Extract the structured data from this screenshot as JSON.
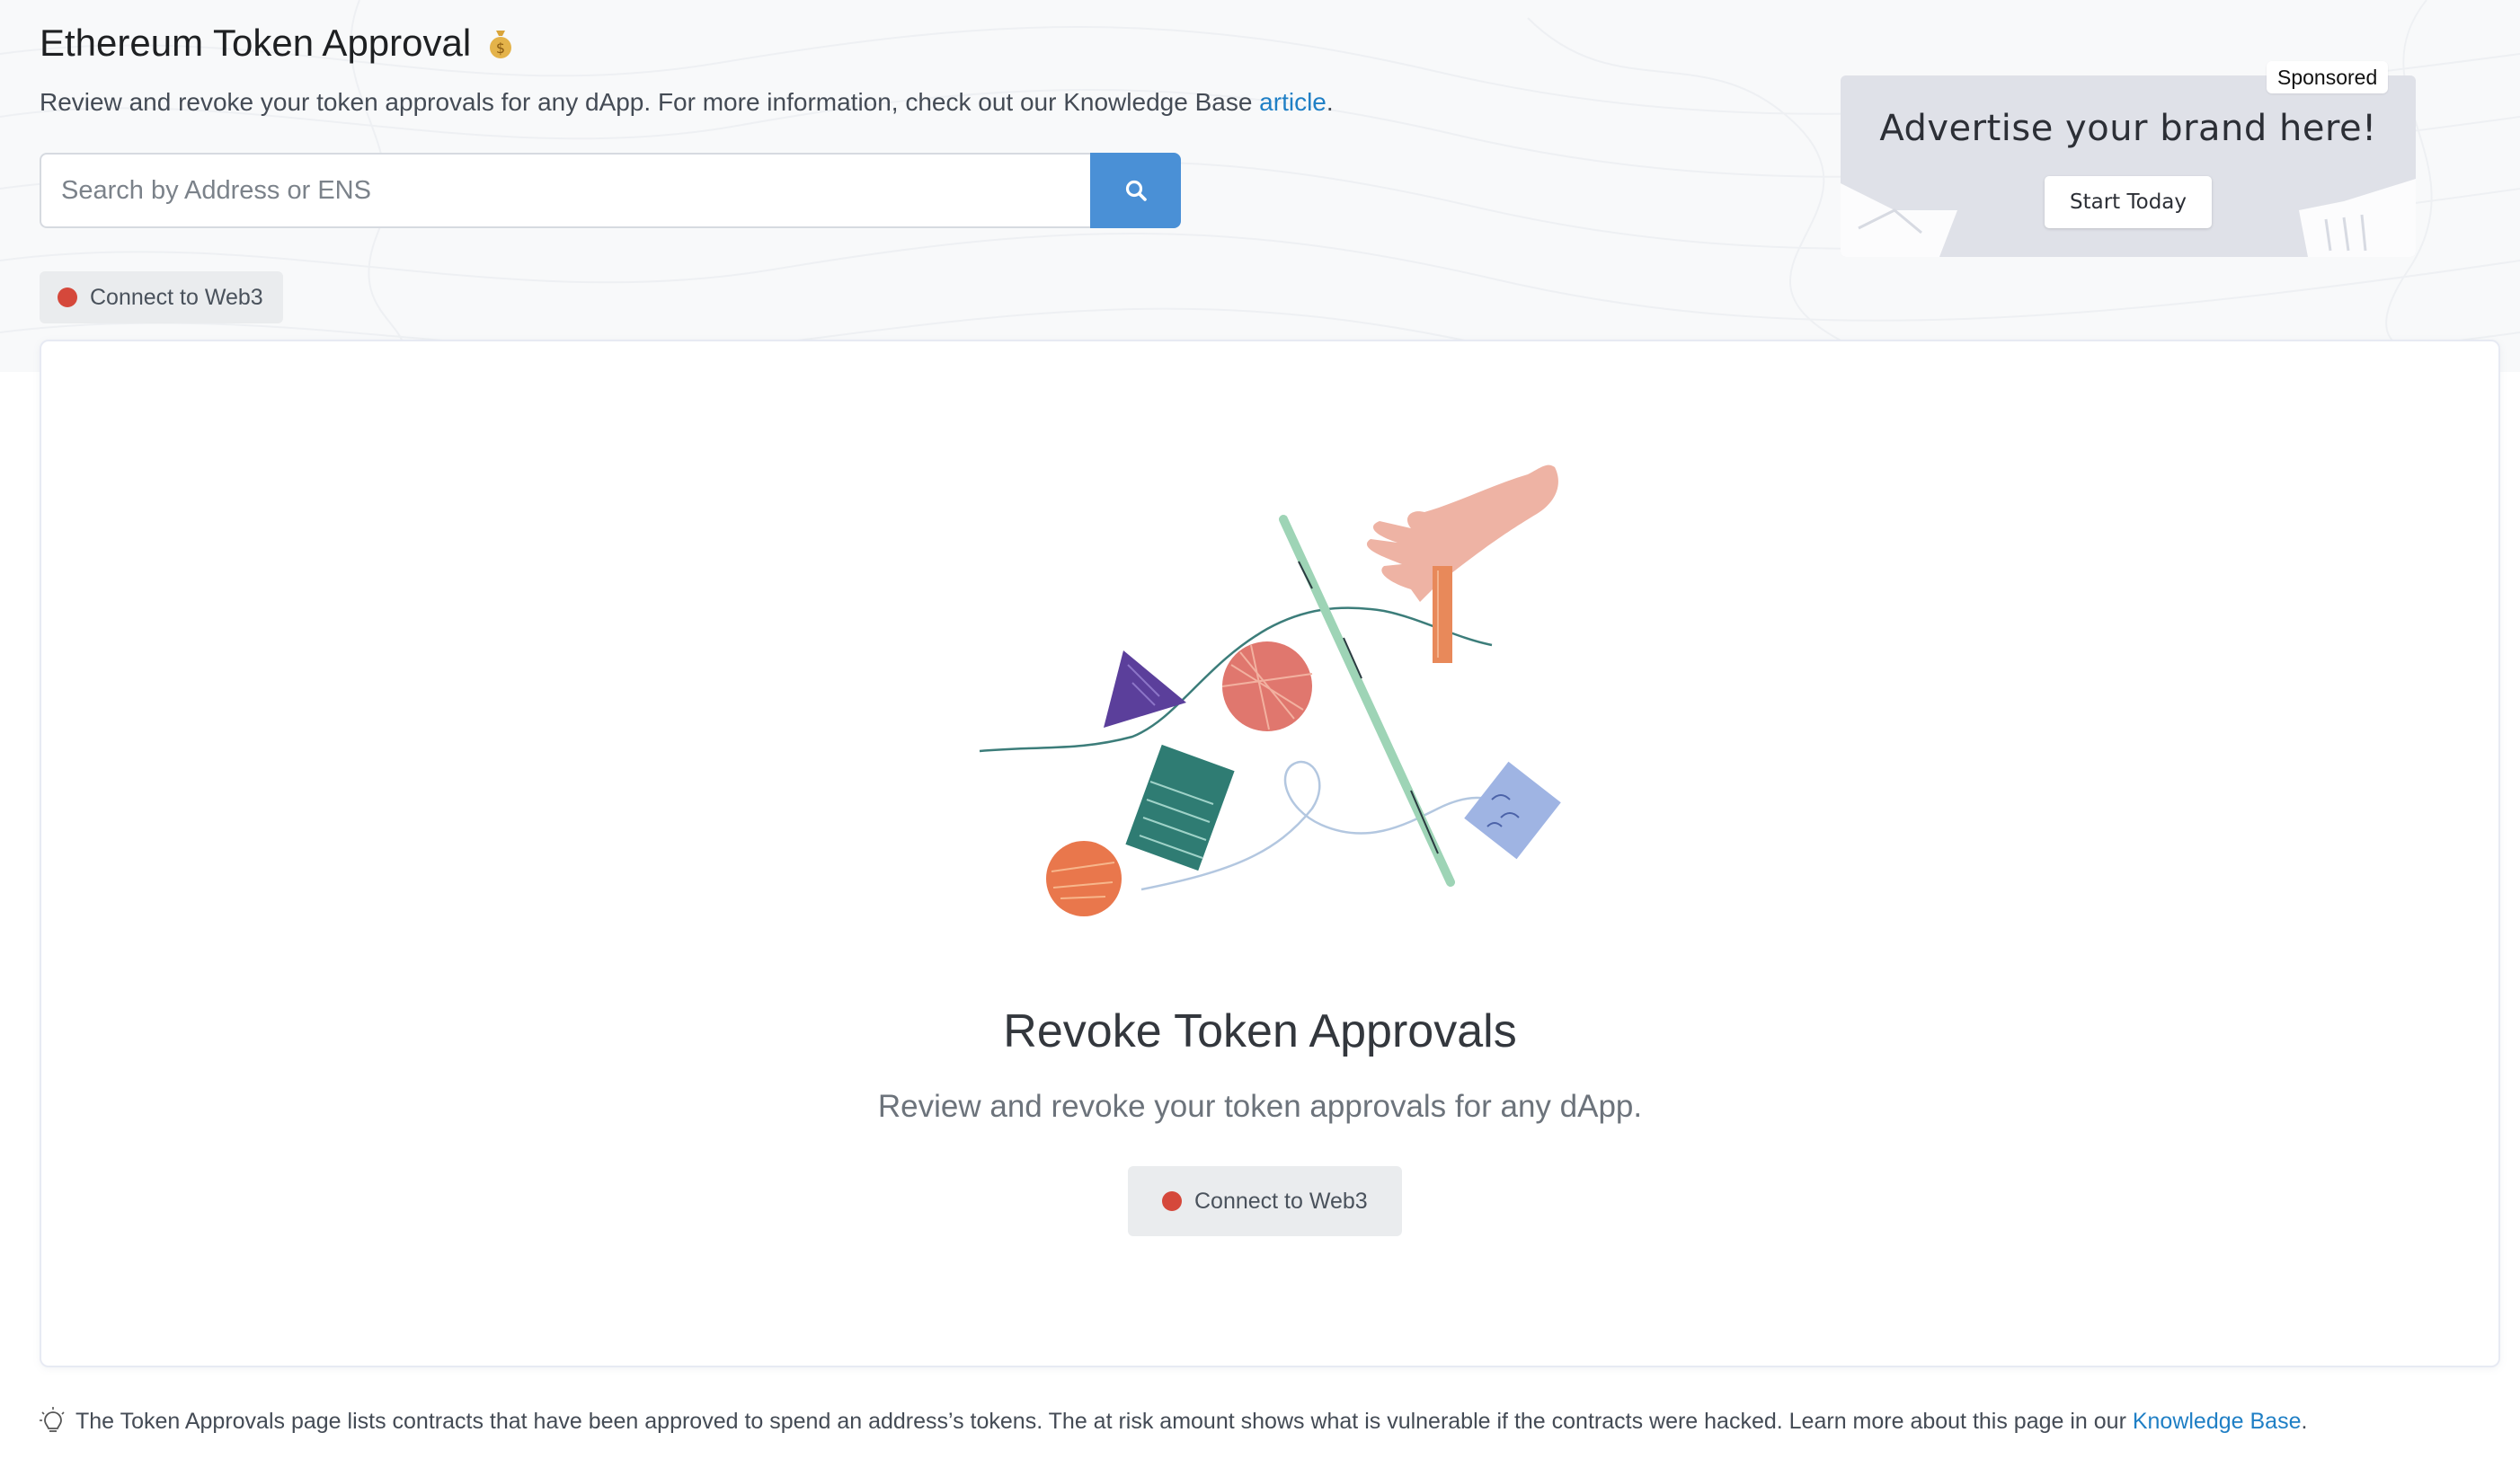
{
  "header": {
    "title": "Ethereum Token Approval",
    "title_icon": "money-bag-icon",
    "subtitle_text": "Review and revoke your token approvals for any dApp. For more information, check out our Knowledge Base ",
    "subtitle_link": "article",
    "subtitle_end": "."
  },
  "search": {
    "placeholder": "Search by Address or ENS",
    "value": "",
    "button_icon": "search-icon"
  },
  "connect_top": {
    "label": "Connect to Web3",
    "status_color": "#d5483b"
  },
  "ad": {
    "badge": "Sponsored",
    "headline": "Advertise your brand here!",
    "cta": "Start Today"
  },
  "card": {
    "title": "Revoke Token Approvals",
    "description": "Review and revoke your token approvals for any dApp.",
    "connect_label": "Connect to Web3"
  },
  "footer": {
    "icon": "lightbulb-icon",
    "text": "The Token Approvals page lists contracts that have been approved to spend an address’s tokens. The at risk amount shows what is vulnerable if the contracts were hacked. Learn more about this page in our ",
    "link": "Knowledge Base",
    "end": "."
  },
  "colors": {
    "accent": "#4a90d6",
    "link": "#1f7fc5",
    "status_red": "#d5483b"
  }
}
